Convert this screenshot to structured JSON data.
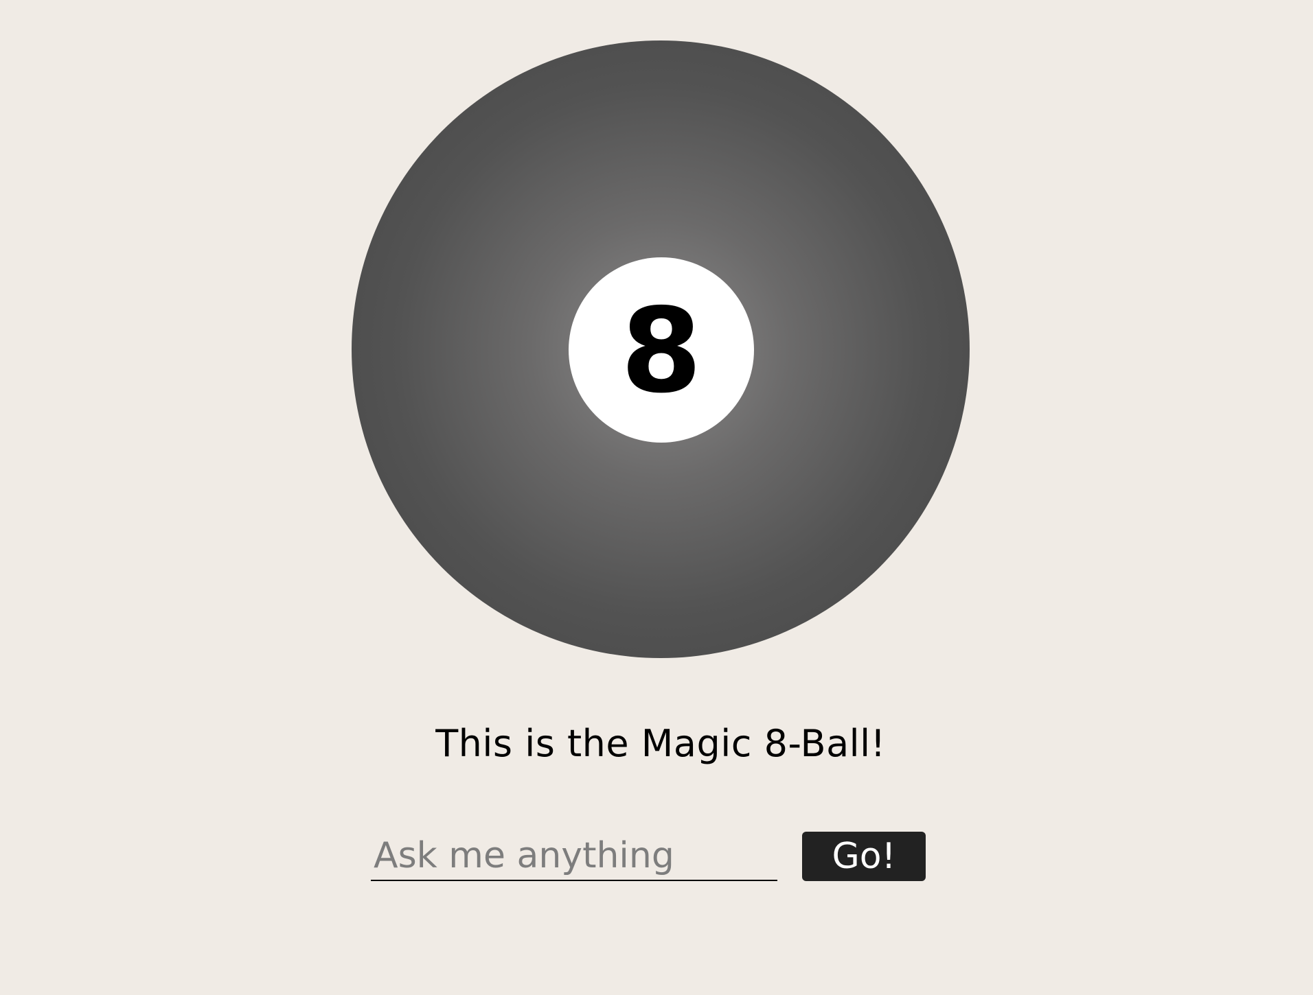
{
  "ball": {
    "number": "8",
    "colors": {
      "ball_center": "#8a8989",
      "ball_edge": "#434343",
      "window": "#ffffff",
      "number": "#000000"
    }
  },
  "tagline": "This is the Magic 8-Ball!",
  "form": {
    "input_value": "",
    "input_placeholder": "Ask me anything",
    "submit_label": "Go!"
  },
  "theme": {
    "background": "#f0ebe5",
    "button_bg": "#222222",
    "button_text": "#ffffff",
    "placeholder": "#7d7d7d"
  }
}
